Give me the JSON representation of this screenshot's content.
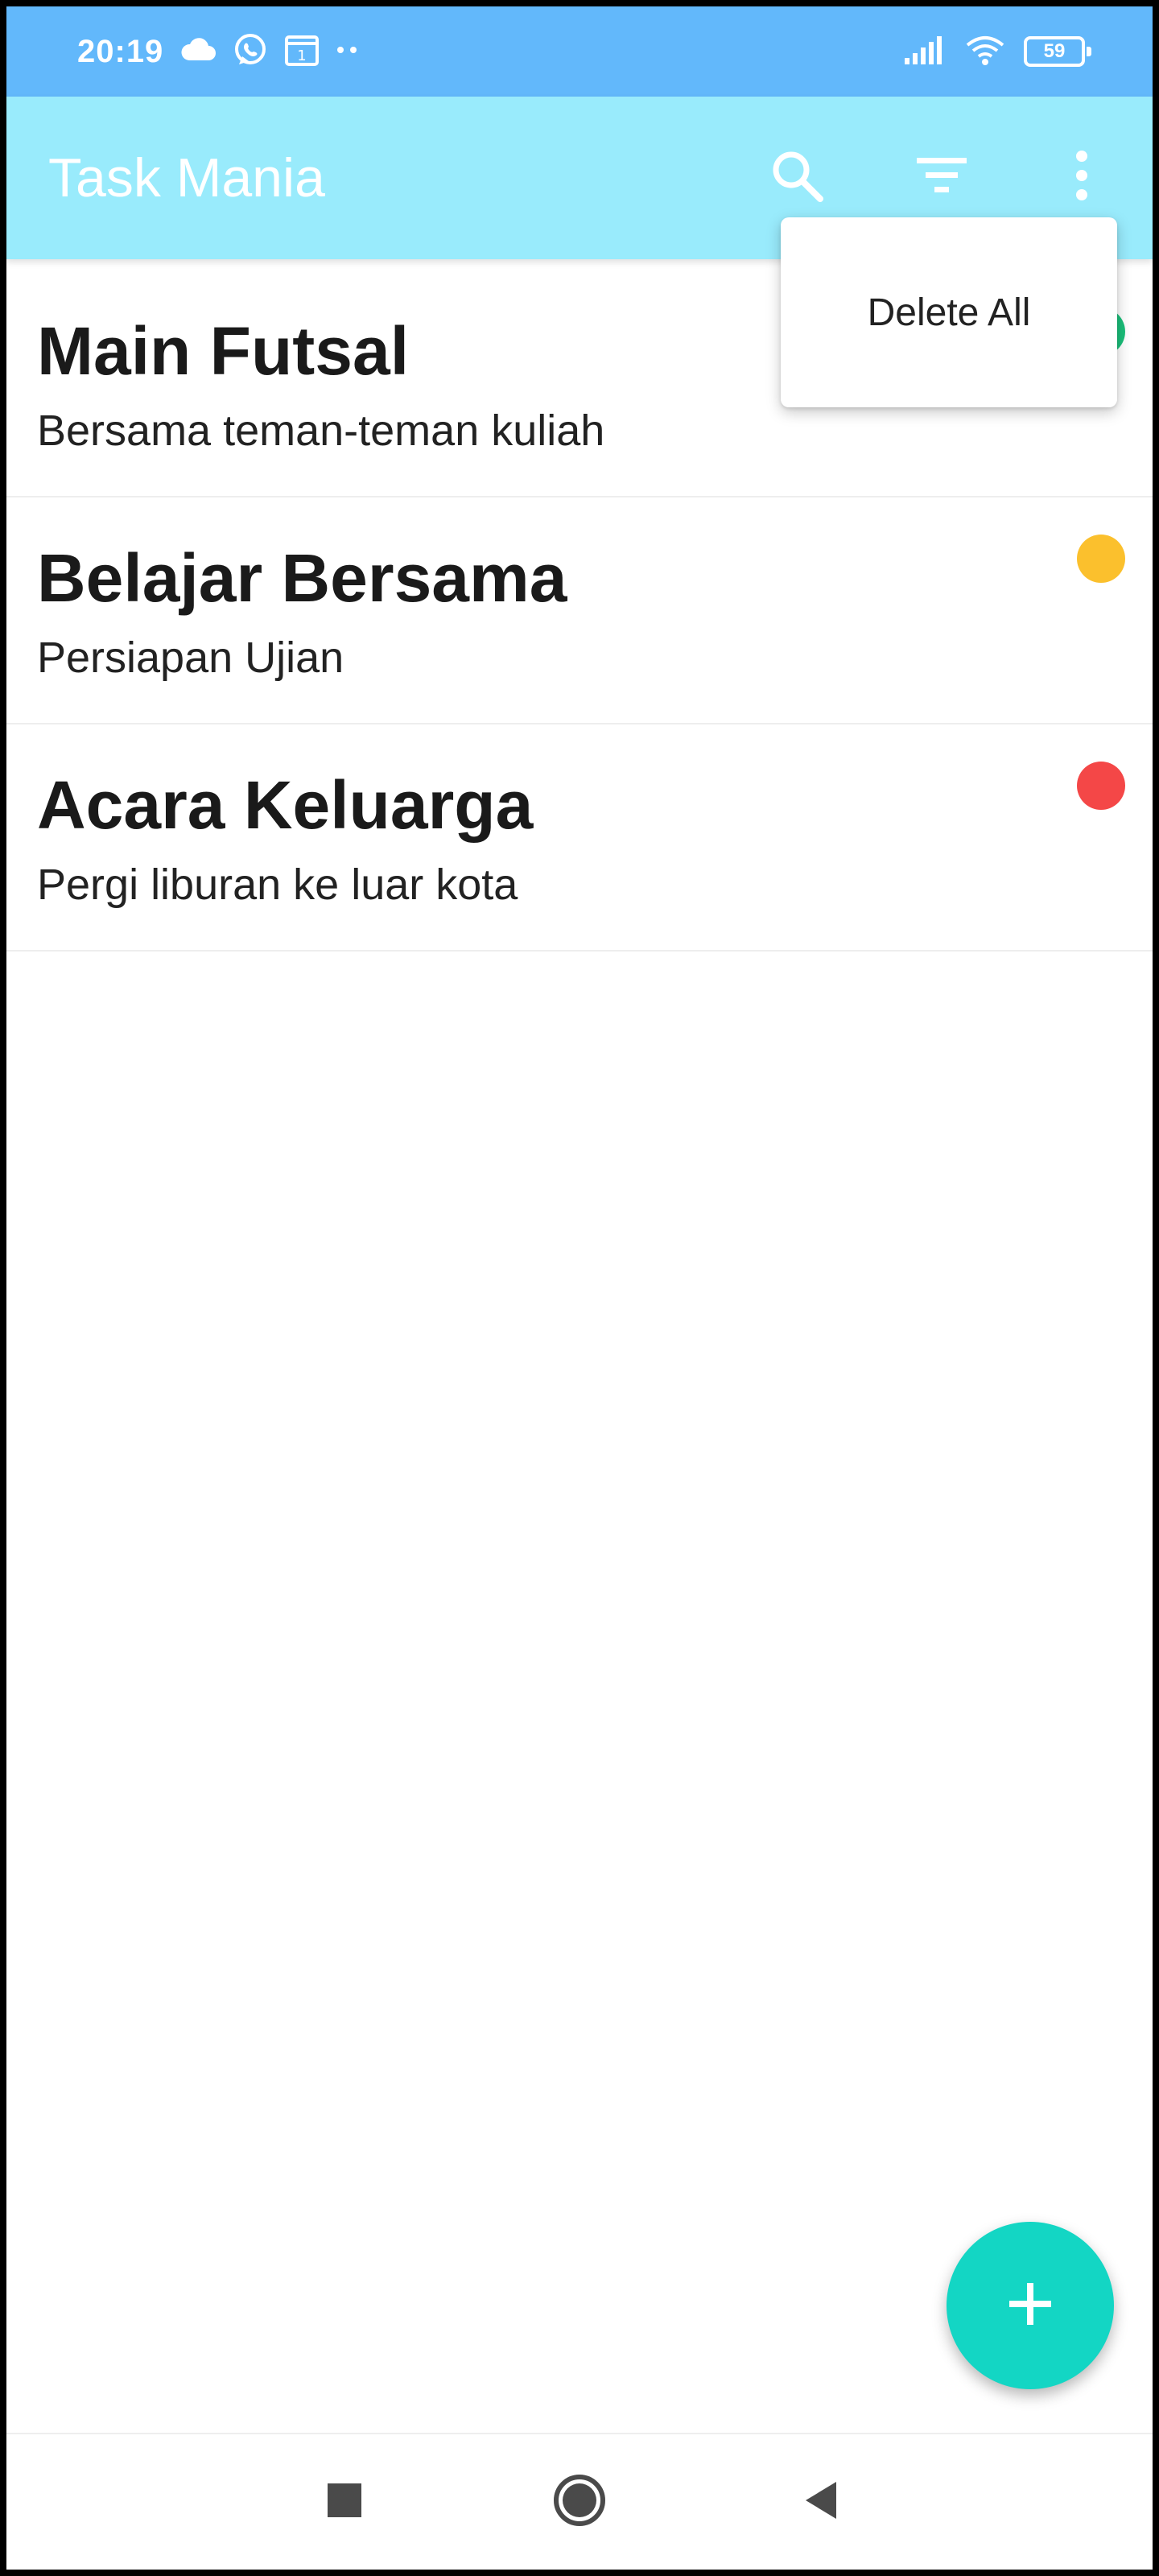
{
  "status_bar": {
    "time": "20:19",
    "battery": "59",
    "icons": [
      "cloud-icon",
      "whatsapp-icon",
      "calendar-icon",
      "more-dots-icon",
      "signal-icon",
      "wifi-icon",
      "battery-icon"
    ]
  },
  "app_bar": {
    "title": "Task Mania",
    "actions": [
      "search-icon",
      "filter-icon",
      "more-vert-icon"
    ]
  },
  "tasks": [
    {
      "title": "Main Futsal",
      "description": "Bersama teman-teman kuliah",
      "priority_color": "#1bbf7a"
    },
    {
      "title": "Belajar Bersama",
      "description": "Persiapan Ujian",
      "priority_color": "#fbc02d"
    },
    {
      "title": "Acara Keluarga",
      "description": "Pergi liburan ke luar kota",
      "priority_color": "#f44747"
    }
  ],
  "overflow_menu": {
    "items": [
      {
        "label": "Delete All"
      }
    ]
  },
  "fab": {
    "icon": "add-icon"
  },
  "nav_bar": {
    "buttons": [
      "recents-icon",
      "home-icon",
      "back-icon"
    ]
  },
  "colors": {
    "status_bar": "#62b8fb",
    "app_bar": "#99ebfc",
    "fab": "#13d6c4"
  }
}
